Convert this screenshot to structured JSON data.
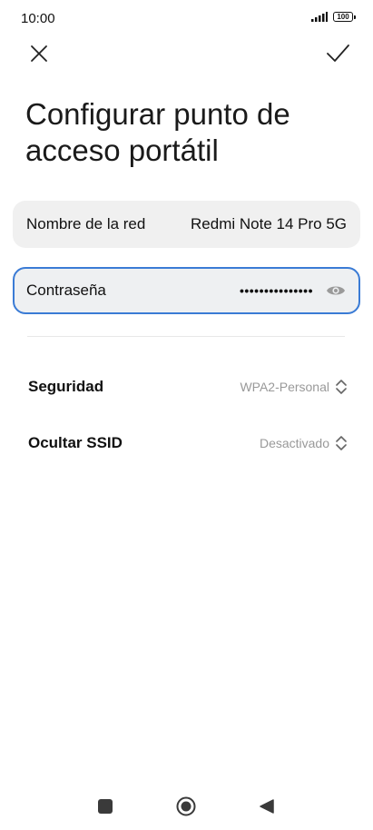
{
  "status_bar": {
    "time": "10:00",
    "battery": "100"
  },
  "header": {
    "close_icon": "close-icon",
    "confirm_icon": "check-icon",
    "title": "Configurar punto de acceso portátil"
  },
  "fields": {
    "network_name": {
      "label": "Nombre de la red",
      "value": "Redmi Note 14 Pro 5G"
    },
    "password": {
      "label": "Contraseña",
      "masked_value": "•••••••••••••••",
      "toggle_icon": "eye-icon"
    }
  },
  "settings": {
    "security": {
      "label": "Seguridad",
      "value": "WPA2-Personal"
    },
    "hide_ssid": {
      "label": "Ocultar SSID",
      "value": "Desactivado"
    }
  },
  "colors": {
    "accent": "#3a7bd5",
    "field_bg": "#f0f0f0",
    "secondary_text": "#999999"
  }
}
